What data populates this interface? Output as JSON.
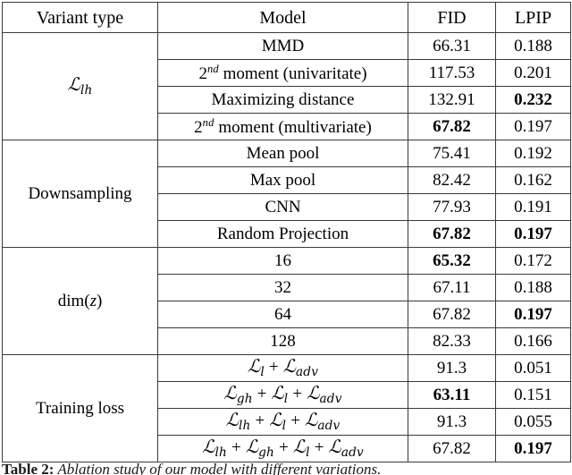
{
  "table": {
    "headers": {
      "variant_type": "Variant type",
      "model": "Model",
      "fid": "FID",
      "lpip": "LPIP"
    },
    "sections": [
      {
        "group_label_math": "L_lh",
        "group_label_text": "ℒlh",
        "rows": [
          {
            "model": "MMD",
            "model_kind": "text",
            "fid": "66.31",
            "fid_bold": false,
            "lpip": "0.188",
            "lpip_bold": false
          },
          {
            "model": "2nd moment (univaritate)",
            "model_kind": "ordinal",
            "ordinal_base": "2",
            "ordinal_sup": "nd",
            "ordinal_rest": " moment (univaritate)",
            "fid": "117.53",
            "fid_bold": false,
            "lpip": "0.201",
            "lpip_bold": false
          },
          {
            "model": "Maximizing distance",
            "model_kind": "text",
            "fid": "132.91",
            "fid_bold": false,
            "lpip": "0.232",
            "lpip_bold": true
          },
          {
            "model": "2nd moment (multivariate)",
            "model_kind": "ordinal",
            "ordinal_base": "2",
            "ordinal_sup": "nd",
            "ordinal_rest": " moment (multivariate)",
            "fid": "67.82",
            "fid_bold": true,
            "lpip": "0.197",
            "lpip_bold": false
          }
        ]
      },
      {
        "group_label_math": "Downsampling",
        "group_label_text": "Downsampling",
        "rows": [
          {
            "model": "Mean pool",
            "model_kind": "text",
            "fid": "75.41",
            "fid_bold": false,
            "lpip": "0.192",
            "lpip_bold": false
          },
          {
            "model": "Max pool",
            "model_kind": "text",
            "fid": "82.42",
            "fid_bold": false,
            "lpip": "0.162",
            "lpip_bold": false
          },
          {
            "model": "CNN",
            "model_kind": "text",
            "fid": "77.93",
            "fid_bold": false,
            "lpip": "0.191",
            "lpip_bold": false
          },
          {
            "model": "Random Projection",
            "model_kind": "text",
            "fid": "67.82",
            "fid_bold": true,
            "lpip": "0.197",
            "lpip_bold": true
          }
        ]
      },
      {
        "group_label_math": "dim(z)",
        "group_label_text": "dim(z)",
        "rows": [
          {
            "model": "16",
            "model_kind": "text",
            "fid": "65.32",
            "fid_bold": true,
            "lpip": "0.172",
            "lpip_bold": false
          },
          {
            "model": "32",
            "model_kind": "text",
            "fid": "67.11",
            "fid_bold": false,
            "lpip": "0.188",
            "lpip_bold": false
          },
          {
            "model": "64",
            "model_kind": "text",
            "fid": "67.82",
            "fid_bold": false,
            "lpip": "0.197",
            "lpip_bold": true
          },
          {
            "model": "128",
            "model_kind": "text",
            "fid": "82.33",
            "fid_bold": false,
            "lpip": "0.166",
            "lpip_bold": false
          }
        ]
      },
      {
        "group_label_math": "Training loss",
        "group_label_text": "Training loss",
        "rows": [
          {
            "model": "L_l + L_adv",
            "model_kind": "loss",
            "loss_terms": [
              "l",
              "adv"
            ],
            "fid": "91.3",
            "fid_bold": false,
            "lpip": "0.051",
            "lpip_bold": false
          },
          {
            "model": "L_gh + L_l + L_adv",
            "model_kind": "loss",
            "loss_terms": [
              "gh",
              "l",
              "adv"
            ],
            "fid": "63.11",
            "fid_bold": true,
            "lpip": "0.151",
            "lpip_bold": false
          },
          {
            "model": "L_lh + L_l + L_adv",
            "model_kind": "loss",
            "loss_terms": [
              "lh",
              "l",
              "adv"
            ],
            "fid": "91.3",
            "fid_bold": false,
            "lpip": "0.055",
            "lpip_bold": false
          },
          {
            "model": "L_lh + L_gh + L_l + L_adv",
            "model_kind": "loss",
            "loss_terms": [
              "lh",
              "gh",
              "l",
              "adv"
            ],
            "fid": "67.82",
            "fid_bold": false,
            "lpip": "0.197",
            "lpip_bold": true
          }
        ]
      }
    ]
  },
  "caption": {
    "label": "Table 2:",
    "text": " Ablation study of our model with different variations."
  },
  "colors": {
    "border": "#3a3a3a",
    "text": "#000000",
    "background": "#ffffff"
  }
}
